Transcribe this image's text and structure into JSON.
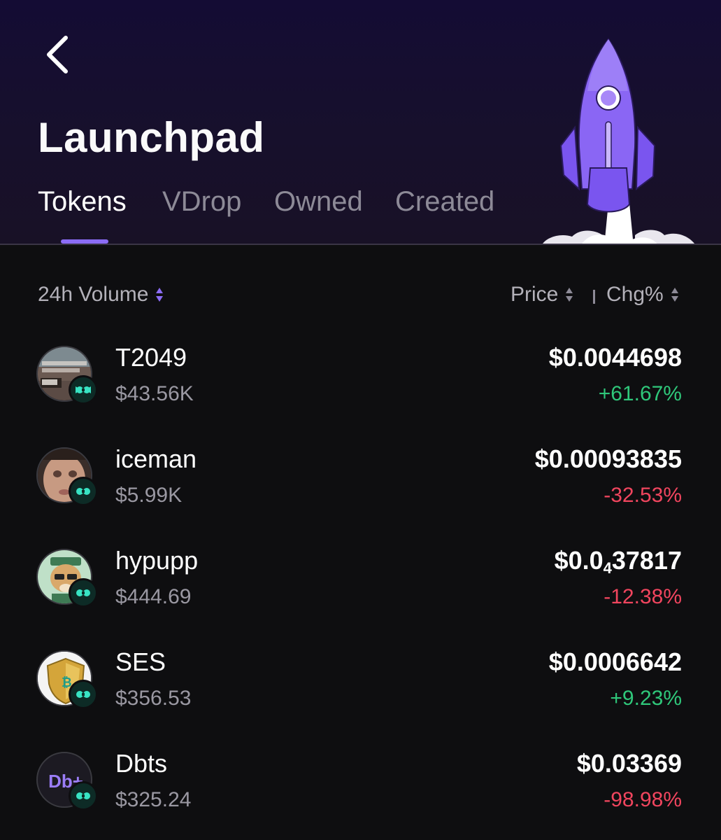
{
  "header": {
    "title": "Launchpad",
    "back_icon": "chevron-left-icon",
    "tabs": [
      {
        "label": "Tokens",
        "active": true
      },
      {
        "label": "VDrop",
        "active": false
      },
      {
        "label": "Owned",
        "active": false
      },
      {
        "label": "Created",
        "active": false
      }
    ],
    "illustration": "rocket-illustration",
    "accent_color": "#8b6cf5"
  },
  "list_header": {
    "volume_label": "24h Volume",
    "price_label": "Price",
    "change_label": "Chg%"
  },
  "colors": {
    "positive": "#2fc77a",
    "negative": "#f0455e",
    "badge": "#38e3c3"
  },
  "tokens": [
    {
      "name": "T2049",
      "volume": "$43.56K",
      "price": "$0.0044698",
      "change": "+61.67%",
      "direction": "up"
    },
    {
      "name": "iceman",
      "volume": "$5.99K",
      "price": "$0.00093835",
      "change": "-32.53%",
      "direction": "down"
    },
    {
      "name": "hypupp",
      "volume": "$444.69",
      "price_prefix": "$0.0",
      "price_zero_count": "4",
      "price_suffix": "37817",
      "change": "-12.38%",
      "direction": "down"
    },
    {
      "name": "SES",
      "volume": "$356.53",
      "price": "$0.0006642",
      "change": "+9.23%",
      "direction": "up"
    },
    {
      "name": "Dbts",
      "volume": "$325.24",
      "price": "$0.03369",
      "change": "-98.98%",
      "direction": "down",
      "avatar_text": "Db+"
    }
  ]
}
